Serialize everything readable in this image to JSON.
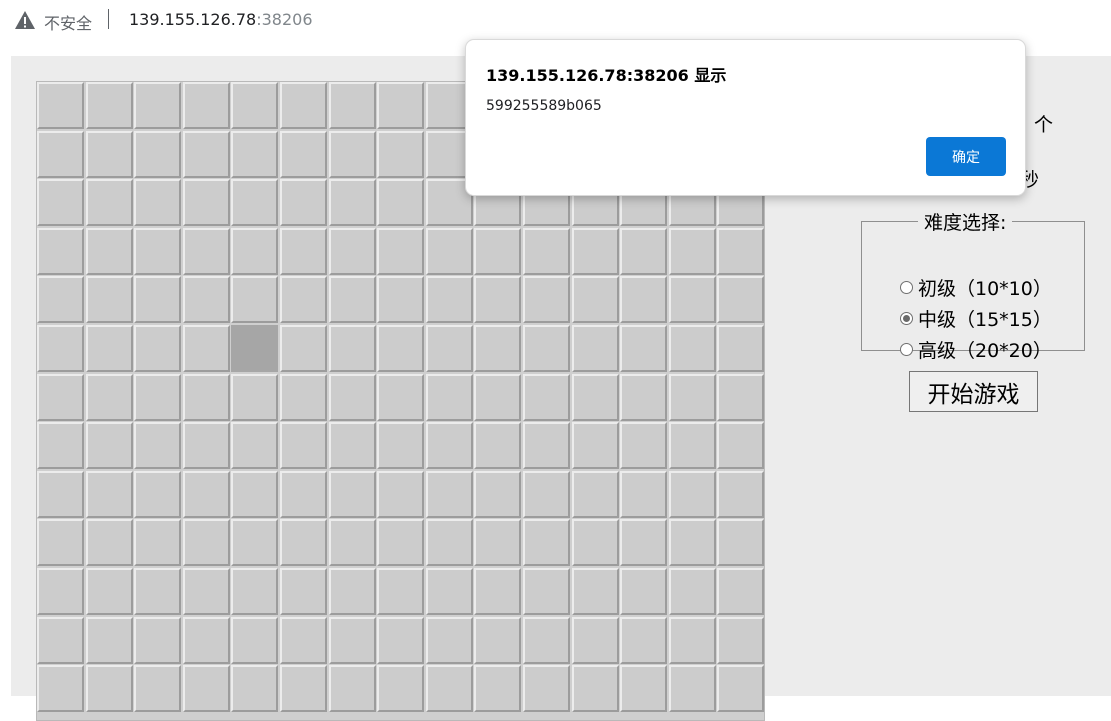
{
  "browser": {
    "security_label": "不安全",
    "url_host": "139.155.126.78",
    "url_port": ":38206"
  },
  "game": {
    "board_rows": 13,
    "board_cols": 15,
    "pressed_cell": {
      "row": 5,
      "col": 4
    },
    "mine_count_unit": "个",
    "time_unit": "秒",
    "difficulty_legend": "难度选择:",
    "options": [
      {
        "label": "初级（10*10）",
        "checked": false
      },
      {
        "label": "中级（15*15）",
        "checked": true
      },
      {
        "label": "高级（20*20）",
        "checked": false
      }
    ],
    "start_button": "开始游戏"
  },
  "dialog": {
    "title": "139.155.126.78:38206 显示",
    "message": "599255589b065",
    "ok_button": "确定"
  },
  "colors": {
    "accent": "#0b78d6",
    "warning_red": "#d32f2f"
  }
}
